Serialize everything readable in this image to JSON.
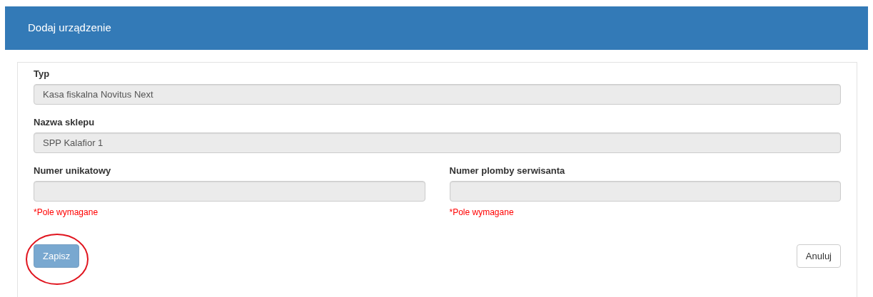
{
  "header": {
    "title": "Dodaj urządzenie"
  },
  "rows": [
    {
      "fields": [
        {
          "label": "Typ",
          "value": "Kasa fiskalna Novitus Next",
          "disabled": true
        }
      ]
    },
    {
      "fields": [
        {
          "label": "Nazwa sklepu",
          "value": "SPP Kalafior 1",
          "disabled": true
        }
      ]
    },
    {
      "fields": [
        {
          "label": "Numer unikatowy",
          "disabled": true,
          "error": "*Pole wymagane"
        },
        {
          "label": "Numer plomby serwisanta",
          "disabled": true,
          "error": "*Pole wymagane"
        }
      ]
    }
  ],
  "buttons": [
    {
      "label": "Zapisz",
      "kind": "primary",
      "disabled": true,
      "circled": true
    },
    {
      "label": "Anuluj",
      "kind": "default",
      "disabled": false,
      "circled": false
    }
  ]
}
